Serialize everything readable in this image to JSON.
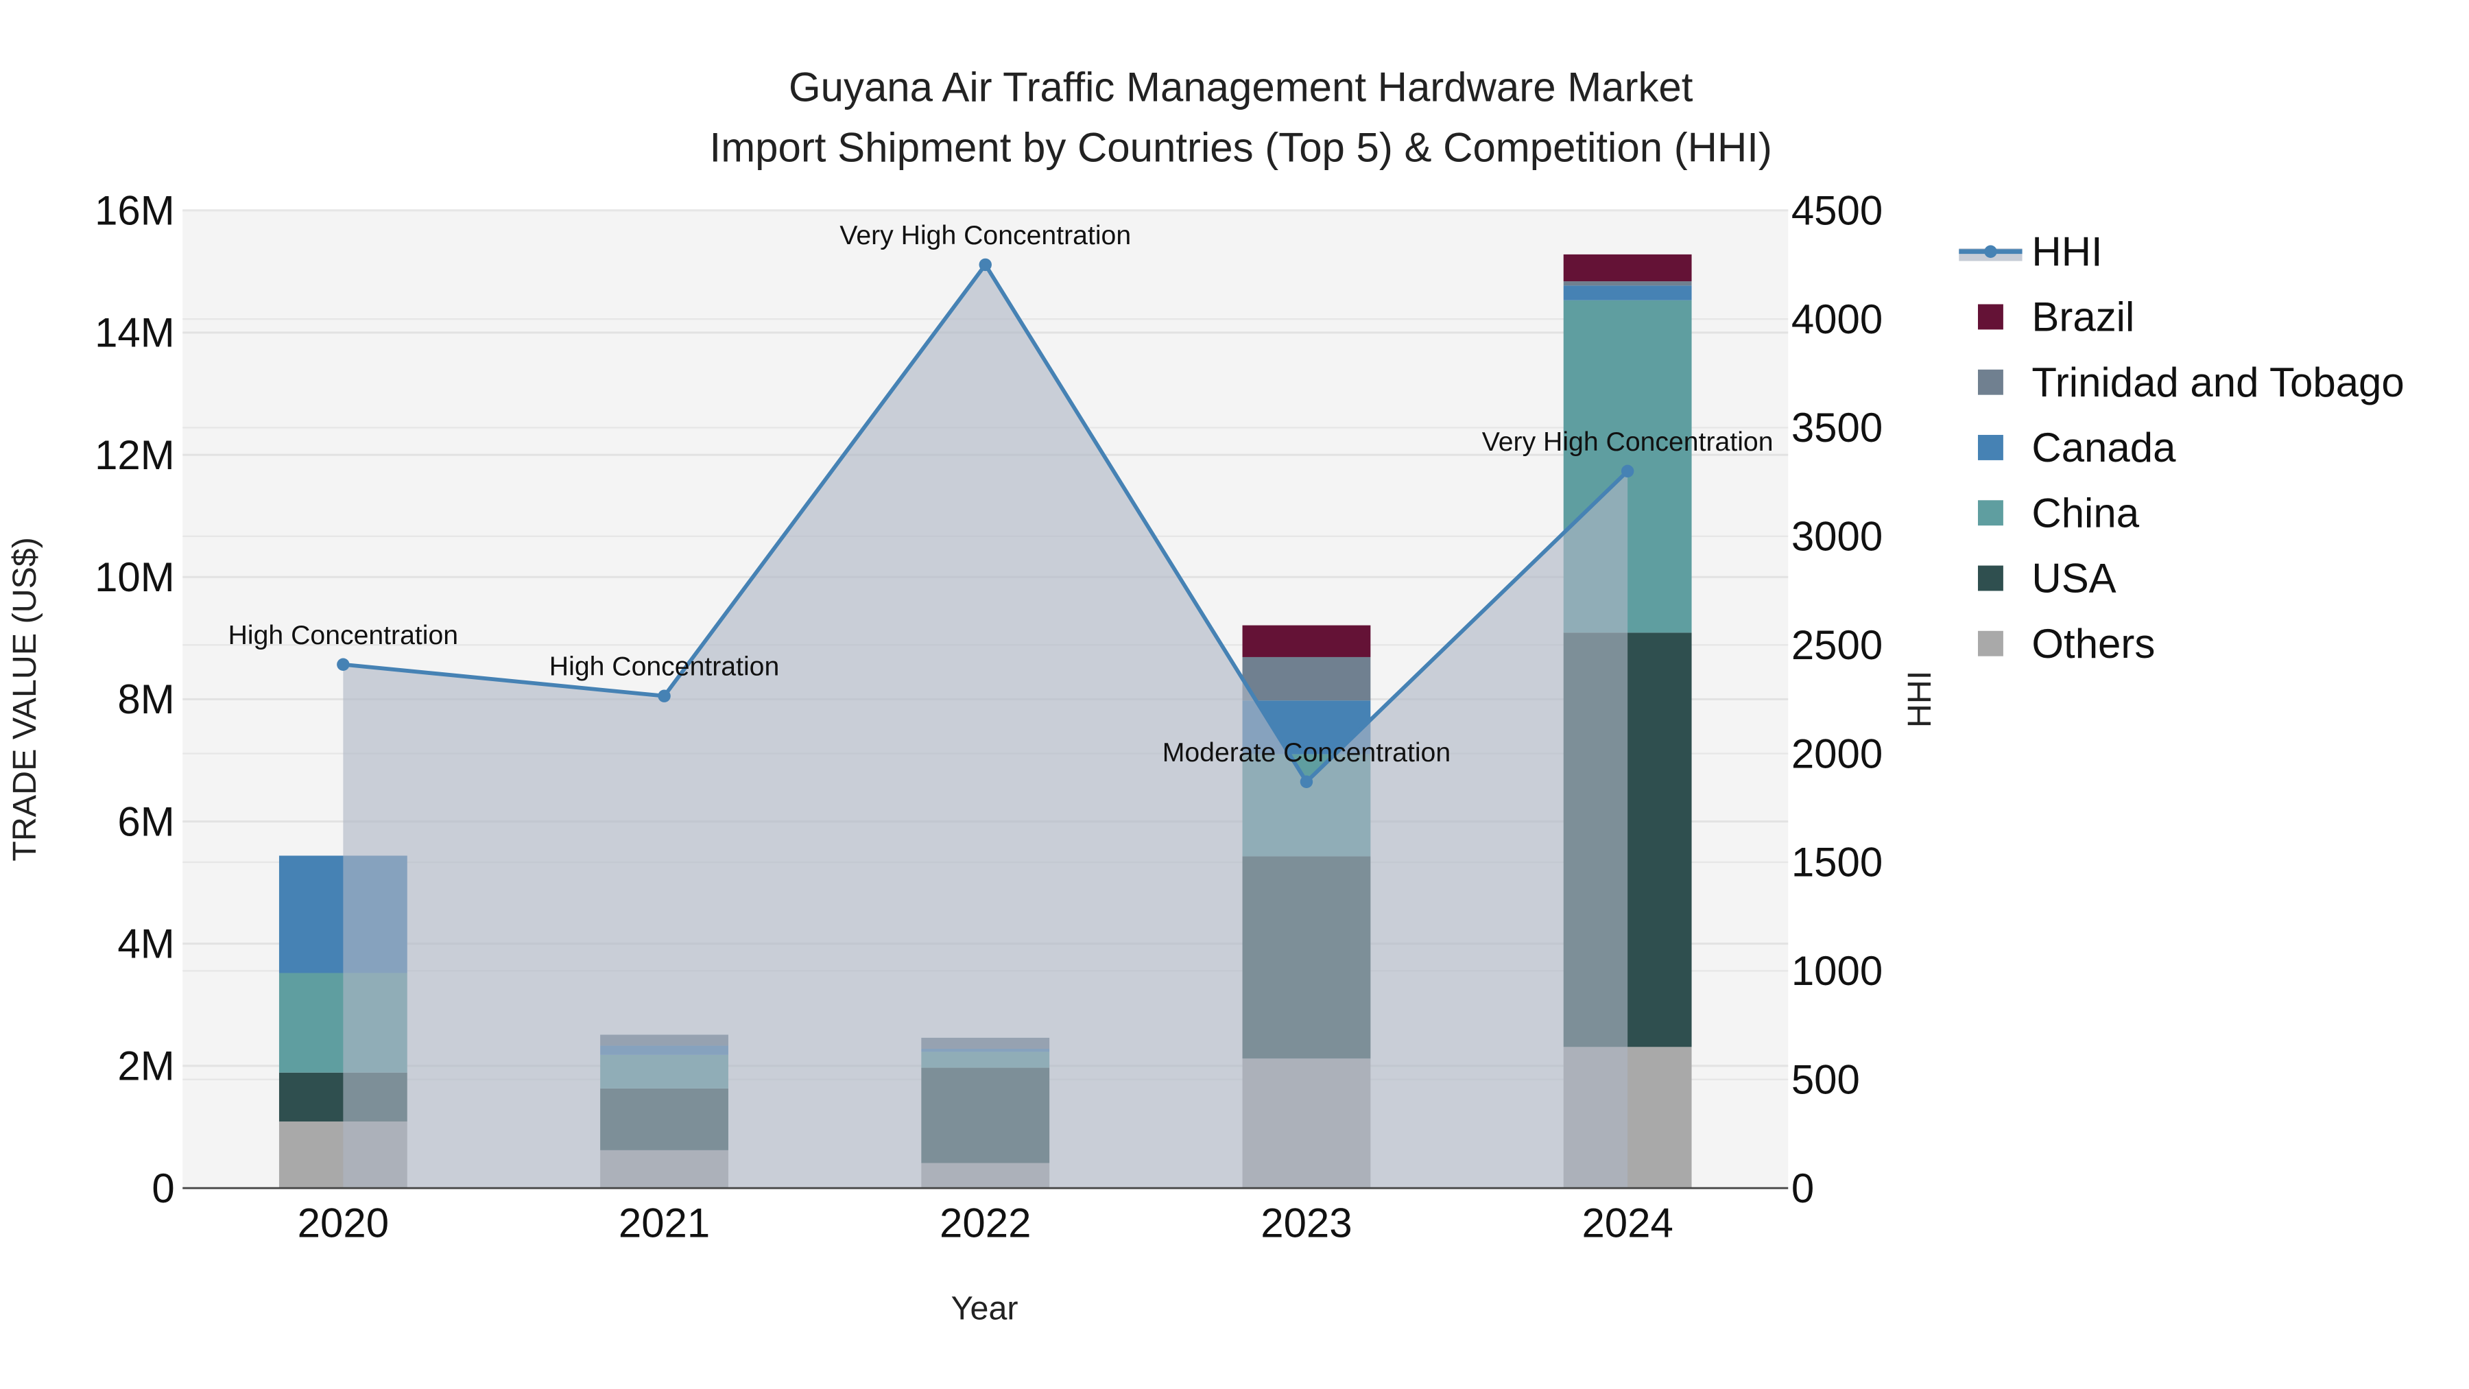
{
  "chart_data": {
    "type": "bar",
    "title_line1": "Guyana Air Traffic Management Hardware Market",
    "title_line2": "Import Shipment by Countries (Top 5) & Competition (HHI)",
    "xlabel": "Year",
    "ylabel": "TRADE VALUE (US$)",
    "y2label": "HHI",
    "categories": [
      "2020",
      "2021",
      "2022",
      "2023",
      "2024"
    ],
    "ylim": [
      0,
      16000000
    ],
    "y2lim": [
      0,
      4500
    ],
    "yticks": [
      0,
      2000000,
      4000000,
      6000000,
      8000000,
      10000000,
      12000000,
      14000000,
      16000000
    ],
    "ytick_labels": [
      "0",
      "2M",
      "4M",
      "6M",
      "8M",
      "10M",
      "12M",
      "14M",
      "16M"
    ],
    "y2ticks": [
      0,
      500,
      1000,
      1500,
      2000,
      2500,
      3000,
      3500,
      4000,
      4500
    ],
    "y2tick_labels": [
      "0",
      "500",
      "1000",
      "1500",
      "2000",
      "2500",
      "3000",
      "3500",
      "4000",
      "4500"
    ],
    "series": [
      {
        "name": "Others",
        "color": "#A9A9A9",
        "values": [
          1090000,
          620000,
          410000,
          2120000,
          2310000
        ]
      },
      {
        "name": "USA",
        "color": "#2F4F4F",
        "values": [
          800000,
          1010000,
          1560000,
          3310000,
          6780000
        ]
      },
      {
        "name": "China",
        "color": "#5F9EA0",
        "values": [
          1630000,
          550000,
          260000,
          1670000,
          5440000
        ]
      },
      {
        "name": "Canada",
        "color": "#4682B4",
        "values": [
          1920000,
          150000,
          50000,
          880000,
          240000
        ]
      },
      {
        "name": "Trinidad and Tobago",
        "color": "#708090",
        "values": [
          0,
          180000,
          180000,
          710000,
          70000
        ]
      },
      {
        "name": "Brazil",
        "color": "#641236",
        "values": [
          0,
          0,
          0,
          520000,
          440000
        ]
      }
    ],
    "hhi": {
      "name": "HHI",
      "color": "#4682B4",
      "values": [
        2410,
        2265,
        4250,
        1870,
        3300
      ],
      "annotations": [
        "High Concentration",
        "High Concentration",
        "Very High Concentration",
        "Moderate Concentration",
        "Very High Concentration"
      ]
    },
    "legend_order": [
      "HHI",
      "Brazil",
      "Trinidad and Tobago",
      "Canada",
      "China",
      "USA",
      "Others"
    ],
    "legend_position": "right",
    "grid": true
  }
}
